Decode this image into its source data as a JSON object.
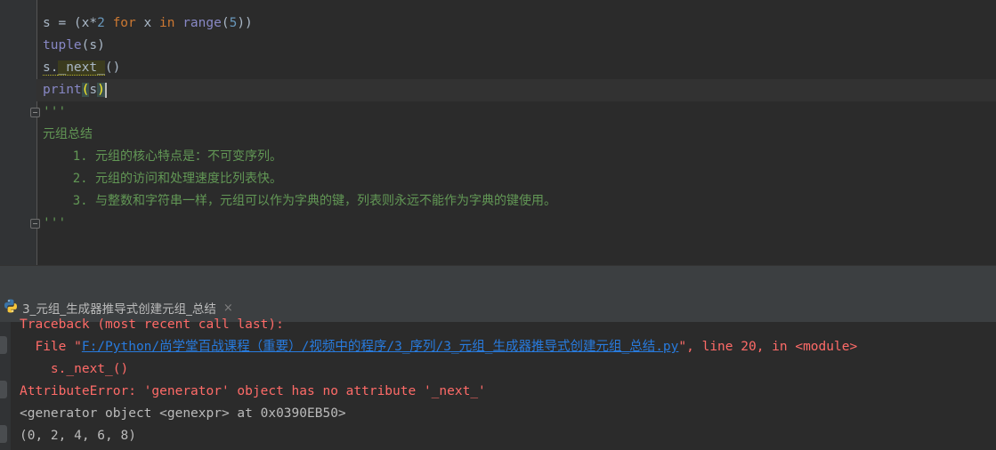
{
  "editor": {
    "lines": {
      "l1": {
        "a": "s = (x*",
        "b": "2",
        "c": " ",
        "d": "for",
        "e": " x ",
        "f": "in",
        "g": " ",
        "h": "range",
        "i": "(",
        "j": "5",
        "k": "))"
      },
      "l2": {
        "a": "tuple",
        "b": "(s)"
      },
      "l3": {
        "a": "s.",
        "b": "_next_",
        "c": "()"
      },
      "l4": {
        "a": "print",
        "b": "(",
        "c": "s",
        "d": ")"
      },
      "l5": "'''",
      "l6": "元组总结",
      "l7": "    1. 元组的核心特点是：不可变序列。",
      "l8": "    2. 元组的访问和处理速度比列表快。",
      "l9": "    3. 与整数和字符串一样，元组可以作为字典的键，列表则永远不能作为字典的键使用。",
      "l10": "'''"
    }
  },
  "run_tab": {
    "title": "3_元组_生成器推导式创建元组_总结",
    "close": "×",
    "icon": "python-icon"
  },
  "console": {
    "traceback": "Traceback (most recent call last):",
    "file_prefix": "  File \"",
    "file_path": "F:/Python/尚学堂百战课程（重要）/视频中的程序/3_序列/3_元组_生成器推导式创建元组_总结.py",
    "file_suffix": "\", line 20, in <module>",
    "code_line": "    s._next_()",
    "error": "AttributeError: 'generator' object has no attribute '_next_'",
    "output1": "<generator object <genexpr> at 0x0390EB50>",
    "output2": "(0, 2, 4, 6, 8)"
  },
  "colors": {
    "background": "#2B2B2B",
    "keyword": "#CC7832",
    "builtin": "#8888C6",
    "number": "#6897BB",
    "docstring": "#629755",
    "error": "#FF6B68",
    "link": "#287BDE"
  }
}
